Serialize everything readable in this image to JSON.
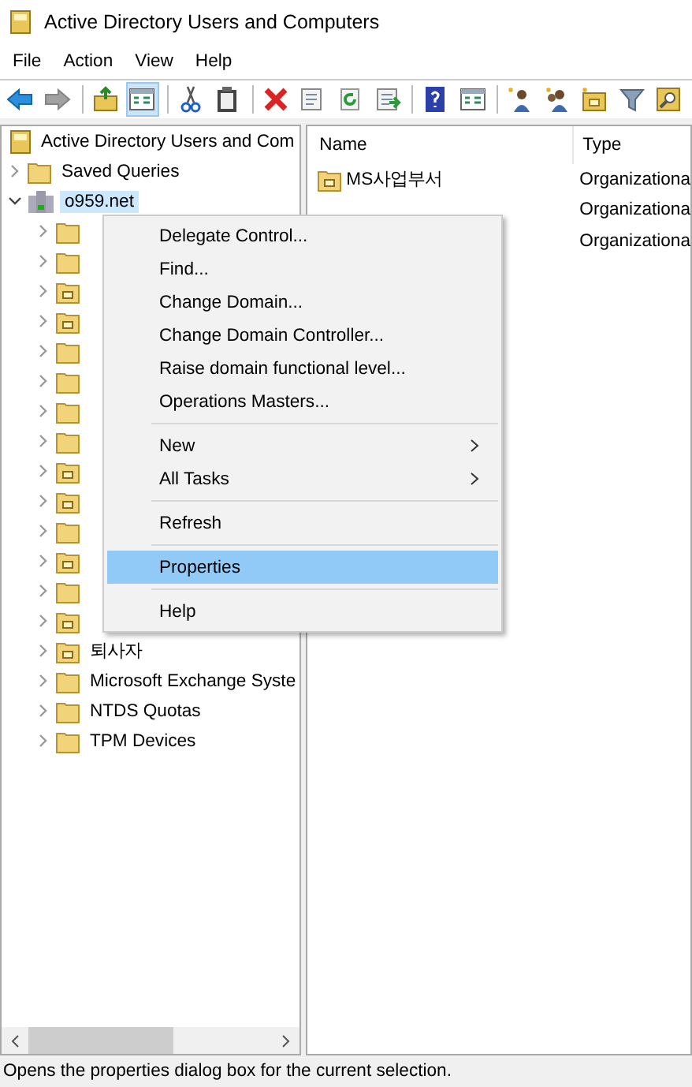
{
  "window": {
    "title": "Active Directory Users and Computers"
  },
  "menu_bar": [
    "File",
    "Action",
    "View",
    "Help"
  ],
  "toolbar": [
    {
      "kind": "back",
      "disabled": false,
      "pressed": false
    },
    {
      "kind": "forward",
      "disabled": true,
      "pressed": false
    },
    {
      "kind": "sep"
    },
    {
      "kind": "up",
      "disabled": false,
      "pressed": false
    },
    {
      "kind": "tree",
      "disabled": false,
      "pressed": true
    },
    {
      "kind": "sep"
    },
    {
      "kind": "cut",
      "disabled": false,
      "pressed": false
    },
    {
      "kind": "paste",
      "disabled": false,
      "pressed": false
    },
    {
      "kind": "sep"
    },
    {
      "kind": "delete",
      "disabled": false,
      "pressed": false
    },
    {
      "kind": "props",
      "disabled": false,
      "pressed": false
    },
    {
      "kind": "refresh",
      "disabled": false,
      "pressed": false
    },
    {
      "kind": "export",
      "disabled": false,
      "pressed": false
    },
    {
      "kind": "sep"
    },
    {
      "kind": "help",
      "disabled": false,
      "pressed": false
    },
    {
      "kind": "console",
      "disabled": false,
      "pressed": false
    },
    {
      "kind": "sep"
    },
    {
      "kind": "user",
      "disabled": false,
      "pressed": false
    },
    {
      "kind": "group",
      "disabled": false,
      "pressed": false
    },
    {
      "kind": "ou",
      "disabled": false,
      "pressed": false
    },
    {
      "kind": "filter",
      "disabled": false,
      "pressed": false
    },
    {
      "kind": "find",
      "disabled": false,
      "pressed": false
    }
  ],
  "tree": {
    "label": "Active Directory Users and Com",
    "kind": "snapin",
    "children": [
      {
        "label": "Saved Queries",
        "kind": "folder",
        "expanded": false,
        "selected": false
      },
      {
        "label": "o959.net",
        "kind": "domain",
        "expanded": true,
        "selected": true,
        "children": [
          {
            "kind": "folder",
            "expanded": false,
            "selected": false
          },
          {
            "kind": "folder",
            "expanded": false,
            "selected": false
          },
          {
            "kind": "ou",
            "expanded": false,
            "selected": false
          },
          {
            "kind": "ou",
            "expanded": false,
            "selected": false
          },
          {
            "kind": "folder",
            "expanded": false,
            "selected": false
          },
          {
            "kind": "folder",
            "expanded": false,
            "selected": false
          },
          {
            "kind": "folder",
            "expanded": false,
            "selected": false
          },
          {
            "kind": "folder",
            "expanded": false,
            "selected": false
          },
          {
            "kind": "ou",
            "expanded": false,
            "selected": false
          },
          {
            "kind": "ou",
            "expanded": false,
            "selected": false
          },
          {
            "kind": "folder",
            "expanded": false,
            "selected": false
          },
          {
            "kind": "ou",
            "expanded": false,
            "selected": false
          },
          {
            "kind": "folder",
            "expanded": false,
            "selected": false
          },
          {
            "kind": "ou",
            "expanded": false,
            "selected": false
          },
          {
            "label": "퇴사자",
            "kind": "ou",
            "expanded": false,
            "selected": false
          },
          {
            "label": "Microsoft Exchange Syste",
            "kind": "folder",
            "expanded": false,
            "selected": false
          },
          {
            "label": "NTDS Quotas",
            "kind": "folder",
            "expanded": false,
            "selected": false
          },
          {
            "label": "TPM Devices",
            "kind": "folder",
            "expanded": false,
            "selected": false
          }
        ]
      }
    ]
  },
  "list": {
    "columns": [
      "Name",
      "Type"
    ],
    "rows": [
      {
        "name": "MS사업부서",
        "type": "Organizationa"
      },
      {
        "type": "Organizationa"
      },
      {
        "type": "Organizationa"
      }
    ]
  },
  "context_menu": [
    {
      "kind": "item",
      "label": "Delegate Control...",
      "selected": false
    },
    {
      "kind": "item",
      "label": "Find...",
      "selected": false
    },
    {
      "kind": "item",
      "label": "Change Domain...",
      "selected": false
    },
    {
      "kind": "item",
      "label": "Change Domain Controller...",
      "selected": false
    },
    {
      "kind": "item",
      "label": "Raise domain functional level...",
      "selected": false
    },
    {
      "kind": "item",
      "label": "Operations Masters...",
      "selected": false
    },
    {
      "kind": "separator"
    },
    {
      "kind": "submenu",
      "label": "New",
      "selected": false
    },
    {
      "kind": "submenu",
      "label": "All Tasks",
      "selected": false
    },
    {
      "kind": "separator"
    },
    {
      "kind": "item",
      "label": "Refresh",
      "selected": false
    },
    {
      "kind": "separator"
    },
    {
      "kind": "item",
      "label": "Properties",
      "selected": true
    },
    {
      "kind": "separator"
    },
    {
      "kind": "item",
      "label": "Help",
      "selected": false
    }
  ],
  "status_bar": "Opens the properties dialog box for the current selection."
}
